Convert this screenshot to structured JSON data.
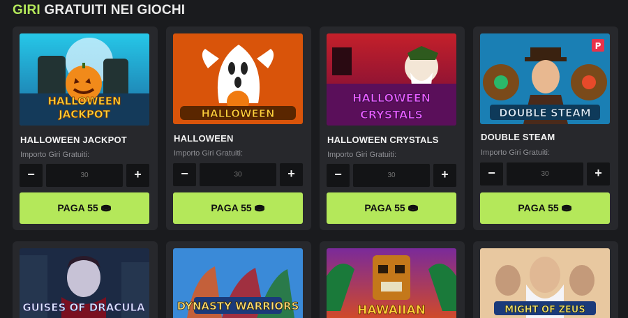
{
  "header": {
    "accent": "GIRI",
    "rest": " GRATUITI NEI GIOCHI"
  },
  "cards": [
    {
      "title": "HALLOWEEN JACKPOT",
      "amount_label": "Importo Giri Gratuiti:",
      "placeholder": "30",
      "pay_label": "PAGA 55",
      "game_logo": [
        "HALLOWEEN",
        "JACKPOT"
      ]
    },
    {
      "title": "HALLOWEEN",
      "amount_label": "Importo Giri Gratuiti:",
      "placeholder": "30",
      "pay_label": "PAGA 55",
      "game_logo": [
        "HALLOWEEN"
      ]
    },
    {
      "title": "HALLOWEEN CRYSTALS",
      "amount_label": "Importo Giri Gratuiti:",
      "placeholder": "30",
      "pay_label": "PAGA 55",
      "game_logo": [
        "HALLOWEEN",
        "CRYSTALS"
      ]
    },
    {
      "title": "DOUBLE STEAM",
      "amount_label": "Importo Giri Gratuiti:",
      "placeholder": "30",
      "pay_label": "PAGA 55",
      "game_logo": [
        "DOUBLE STEAM"
      ],
      "badge": "P"
    }
  ],
  "bottom_cards": [
    {
      "game_logo": "GUISES OF DRACULA"
    },
    {
      "game_logo": "DYNASTY WARRIORS"
    },
    {
      "game_logo": "HAWAIIAN"
    },
    {
      "game_logo": "MIGHT OF ZEUS"
    }
  ],
  "stepper": {
    "minus": "−",
    "plus": "+"
  },
  "colors": {
    "accent": "#b4e85a",
    "card": "#27282c",
    "background": "#1a1b1e"
  },
  "icons": [
    "coin-icon"
  ]
}
